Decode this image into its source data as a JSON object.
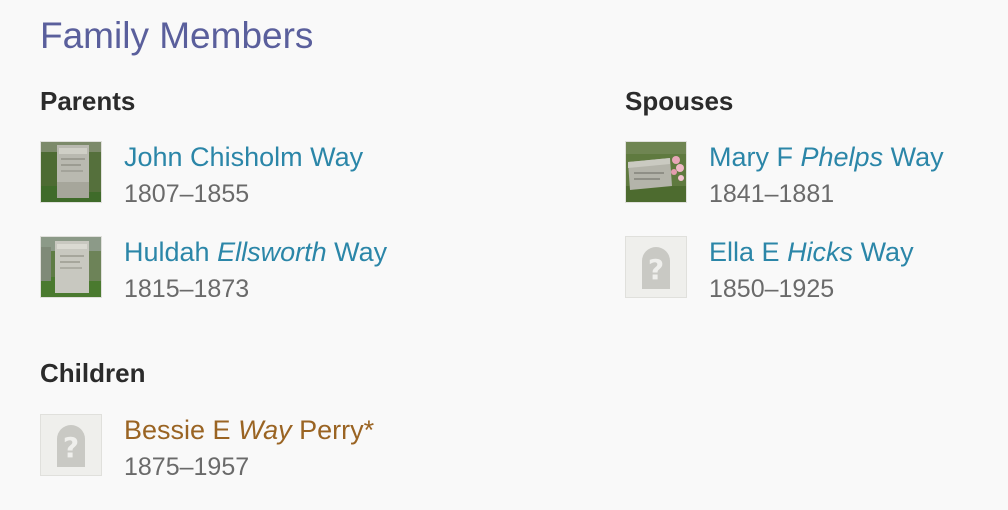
{
  "section": {
    "title": "Family Members"
  },
  "parents": {
    "heading": "Parents",
    "members": [
      {
        "first": "John Chisholm",
        "maiden": "",
        "last": "Way",
        "suffix": "",
        "dates": "1807–1855",
        "photo": "headstone-photo"
      },
      {
        "first": "Huldah",
        "maiden": "Ellsworth",
        "last": "Way",
        "suffix": "",
        "dates": "1815–1873",
        "photo": "headstone-photo"
      }
    ]
  },
  "spouses": {
    "heading": "Spouses",
    "members": [
      {
        "first": "Mary F",
        "maiden": "Phelps",
        "last": "Way",
        "suffix": "",
        "dates": "1841–1881",
        "photo": "headstone-photo"
      },
      {
        "first": "Ella E",
        "maiden": "Hicks",
        "last": "Way",
        "suffix": "",
        "dates": "1850–1925",
        "photo": "no-photo-placeholder"
      }
    ]
  },
  "children": {
    "heading": "Children",
    "members": [
      {
        "first": "Bessie E",
        "maiden": "Way",
        "last": "Perry",
        "suffix": "*",
        "dates": "1875–1957",
        "photo": "no-photo-placeholder"
      }
    ]
  },
  "colors": {
    "title": "#5a5f9c",
    "link": "#2b86a8",
    "highlight_link": "#9a6423",
    "dates": "#6a6a6a",
    "heading": "#2b2b2b",
    "background": "#f9f9f9"
  }
}
